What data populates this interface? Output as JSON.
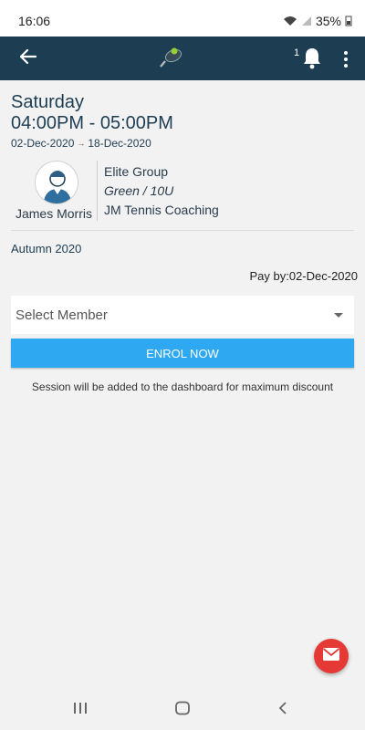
{
  "status_bar": {
    "time": "16:06",
    "battery": "35%"
  },
  "app_bar": {
    "notification_count": "1",
    "colors": {
      "background": "#1d3d52"
    }
  },
  "session": {
    "day": "Saturday",
    "time": "04:00PM - 05:00PM",
    "start_date": "02-Dec-2020",
    "end_date": "18-Dec-2020",
    "coach_name": "James Morris",
    "group_name": "Elite Group",
    "level": "Green / 10U",
    "provider": "JM Tennis Coaching",
    "term": "Autumn 2020",
    "pay_by": "Pay by:02-Dec-2020"
  },
  "form": {
    "select_member": "Select Member",
    "enrol_label": "ENROL NOW",
    "note": "Session will be added to the dashboard for maximum discount"
  },
  "icons": {
    "back": "back-arrow-icon",
    "logo": "tennis-racket-logo",
    "notification": "bell-icon",
    "menu": "more-vert-icon",
    "mail": "mail-icon"
  },
  "colors": {
    "accent": "#2ea8f0",
    "fab": "#e53935",
    "primary_text": "#1d3d52"
  }
}
